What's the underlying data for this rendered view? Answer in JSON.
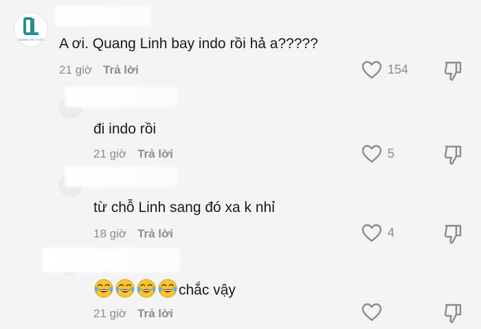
{
  "comments": [
    {
      "avatar_label": "QUANG LINH VLOG",
      "text": "A ơi. Quang Linh bay indo rồi hả a?????",
      "time": "21 giờ",
      "reply_label": "Trả lời",
      "likes": "154"
    },
    {
      "text": "đi indo rồi",
      "time": "21 giờ",
      "reply_label": "Trả lời",
      "likes": "5"
    },
    {
      "text": "từ chỗ Linh sang đó xa k nhỉ",
      "time": "18 giờ",
      "reply_label": "Trả lời",
      "likes": "4"
    },
    {
      "emoji_count": 4,
      "emoji_name": "face-with-tears-of-joy",
      "text": "chắc vậy",
      "time": "21 giờ",
      "reply_label": "Trả lời",
      "likes": ""
    }
  ],
  "icons": {
    "like": "heart-outline-icon",
    "dislike": "thumbs-down-outline-icon"
  },
  "colors": {
    "background": "#f4f4f4",
    "text": "#161823",
    "meta": "#8a8b91",
    "logo_green": "#2a8d8f"
  }
}
